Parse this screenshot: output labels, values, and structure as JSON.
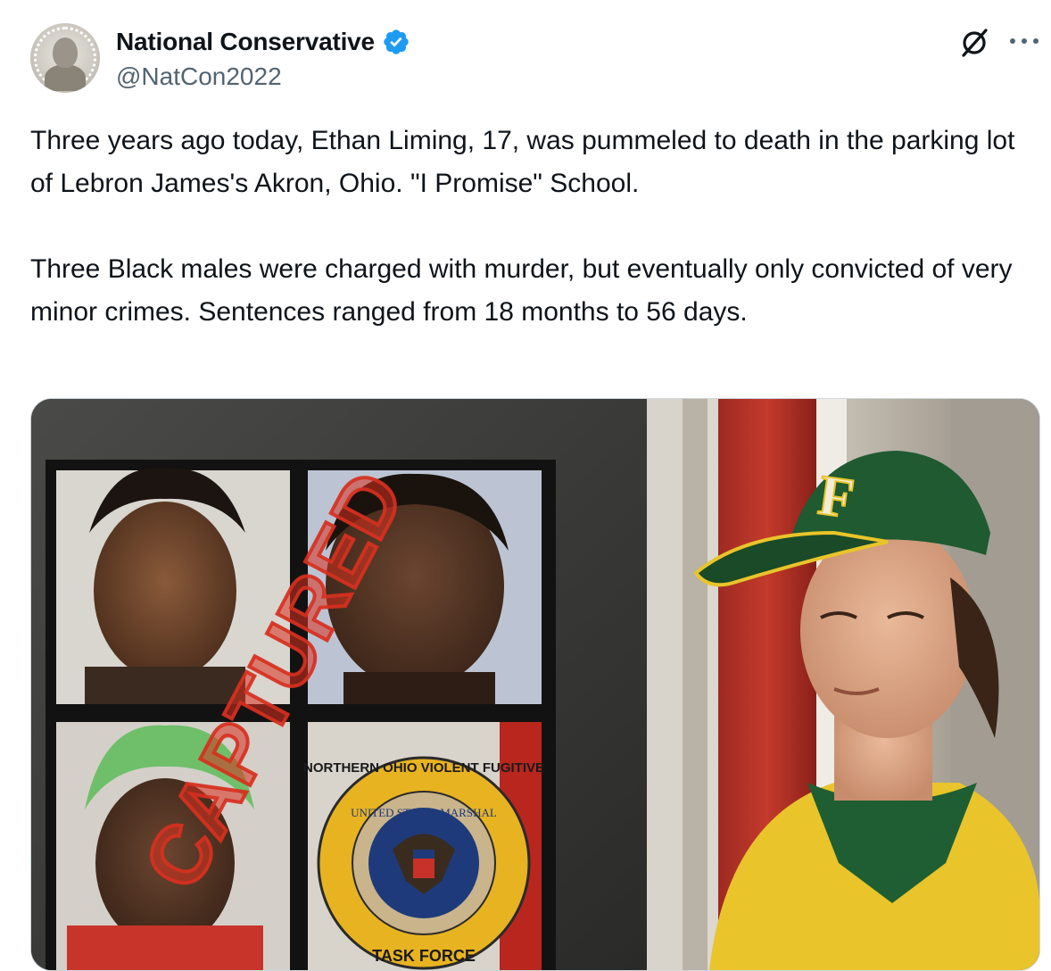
{
  "author": {
    "display_name": "National Conservative",
    "handle": "@NatCon2022",
    "verified": true
  },
  "post": {
    "text": "Three years ago today, Ethan Liming, 17, was pummeled to death in the parking lot of Lebron James's Akron, Ohio. \"I Promise\" School.\n\nThree Black males were charged with murder, but eventually only convicted of very minor crimes. Sentences ranged from 18 months to 56 days."
  },
  "actions": {
    "grok_icon": "grok-icon",
    "more_icon": "more-icon"
  },
  "media": {
    "stamp_text": "CAPTURED",
    "seal_text_top": "NORTHERN OHIO VIOLENT FUGITIVE",
    "seal_text_inner": "UNITED STATES MARSHAL",
    "seal_text_bottom": "TASK FORCE",
    "cap_letter": "F"
  },
  "colors": {
    "verified_blue": "#1d9bf0",
    "text_primary": "#0f1419",
    "text_secondary": "#536471",
    "stamp_red": "#d8301f",
    "jersey_yellow": "#e9c42a",
    "jersey_green": "#1f5e33"
  }
}
